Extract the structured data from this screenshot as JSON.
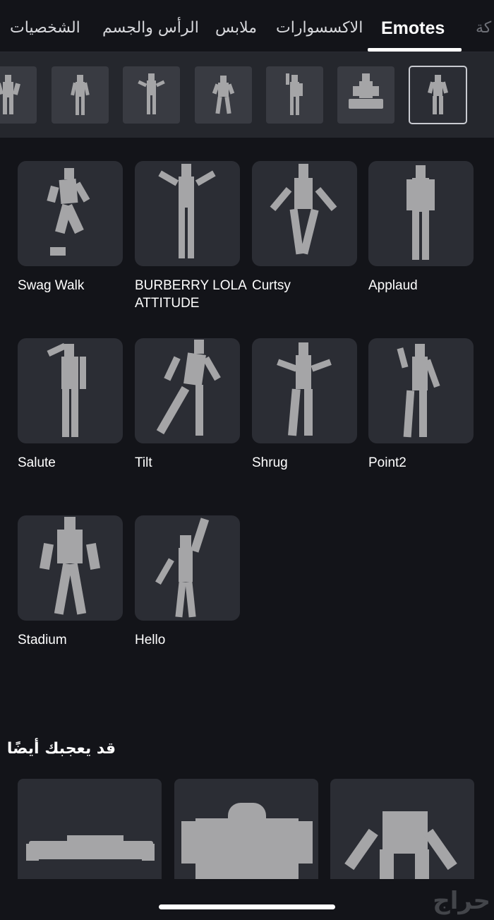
{
  "tabs": [
    {
      "label": "الشخصيات"
    },
    {
      "label": "الرأس والجسم"
    },
    {
      "label": "ملابس"
    },
    {
      "label": "الاكسسوارات"
    },
    {
      "label": "Emotes"
    },
    {
      "label": "كة"
    }
  ],
  "active_tab_index": 4,
  "subcategories": [
    {
      "icon": "avatar-pose-icon"
    },
    {
      "icon": "avatar-pose-icon"
    },
    {
      "icon": "avatar-pose-icon"
    },
    {
      "icon": "avatar-pose-icon"
    },
    {
      "icon": "avatar-pose-icon"
    },
    {
      "icon": "avatar-sitting-icon"
    },
    {
      "icon": "avatar-pose-icon"
    }
  ],
  "selected_subcategory_index": 6,
  "emotes": [
    {
      "name": "Swag Walk"
    },
    {
      "name": "BURBERRY LOLA ATTITUDE"
    },
    {
      "name": "Curtsy"
    },
    {
      "name": "Applaud"
    },
    {
      "name": "Salute"
    },
    {
      "name": "Tilt"
    },
    {
      "name": "Shrug"
    },
    {
      "name": "Point2"
    },
    {
      "name": "Stadium"
    },
    {
      "name": "Hello"
    }
  ],
  "recommended": {
    "title": "قد يعجبك أيضًا",
    "items": [
      {
        "icon": "avatar-thumbnail"
      },
      {
        "icon": "avatar-thumbnail"
      },
      {
        "icon": "avatar-thumbnail"
      }
    ]
  },
  "watermark": "حراج",
  "colors": {
    "background": "#131419",
    "card": "#2b2d34",
    "strip": "#25272d",
    "figure": "#a5a5a7"
  }
}
